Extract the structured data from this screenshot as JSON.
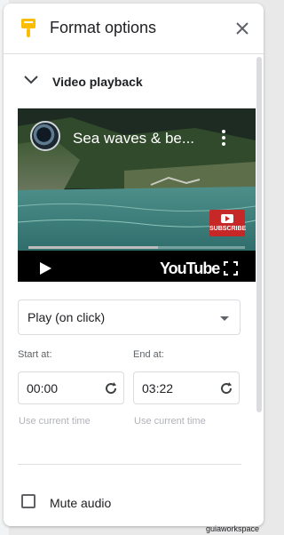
{
  "panel": {
    "title": "Format options",
    "header_icon": "paint-brush-icon",
    "close_icon": "close-icon"
  },
  "section": {
    "title": "Video playback",
    "expanded": true,
    "icon": "chevron-down-icon"
  },
  "video": {
    "title": "Sea waves & be...",
    "channel_avatar": "channel-avatar",
    "subscribe_label": "SUBSCRIBE",
    "brand_label": "YouTube",
    "progress": 0.6,
    "icons": [
      "more-vert-icon",
      "play-icon",
      "fullscreen-icon"
    ]
  },
  "playback": {
    "selected": "Play (on click)"
  },
  "timing": {
    "start_label": "Start at:",
    "start_value": "00:00",
    "end_label": "End at:",
    "end_value": "03:22",
    "use_current_start": "Use current time",
    "use_current_end": "Use current time"
  },
  "mute": {
    "label": "Mute audio",
    "checked": false
  },
  "watermark": "guiaworkspace",
  "colors": {
    "accent": "#fbbc04",
    "subscribe_red": "#c62828"
  }
}
